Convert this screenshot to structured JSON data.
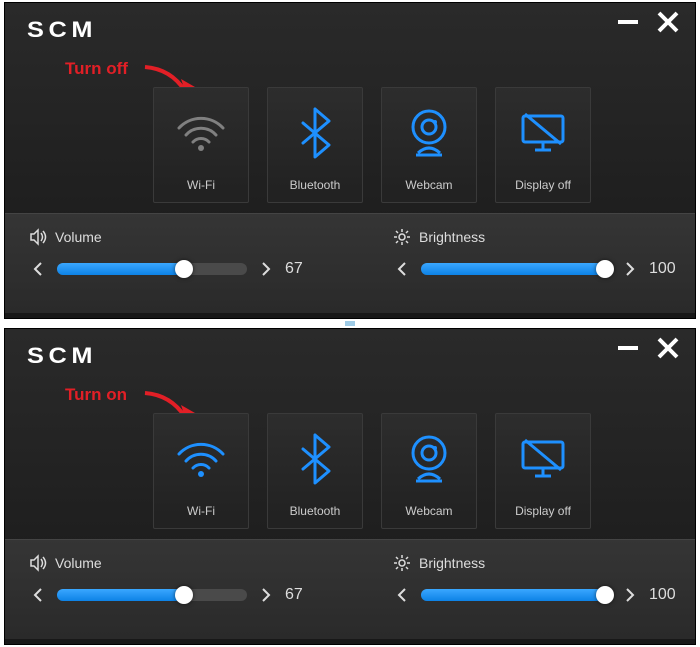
{
  "app_title": "SCM",
  "colors": {
    "accent": "#1e90ff",
    "off": "#808080",
    "annot": "#e21f26"
  },
  "panels": [
    {
      "annotation": "Turn off",
      "wifi_active": false,
      "tiles": [
        {
          "id": "wifi",
          "label": "Wi-Fi"
        },
        {
          "id": "bluetooth",
          "label": "Bluetooth"
        },
        {
          "id": "webcam",
          "label": "Webcam"
        },
        {
          "id": "displayoff",
          "label": "Display off"
        }
      ],
      "volume": {
        "label": "Volume",
        "value": 67,
        "percent": 67
      },
      "brightness": {
        "label": "Brightness",
        "value": 100,
        "percent": 100
      }
    },
    {
      "annotation": "Turn on",
      "wifi_active": true,
      "tiles": [
        {
          "id": "wifi",
          "label": "Wi-Fi"
        },
        {
          "id": "bluetooth",
          "label": "Bluetooth"
        },
        {
          "id": "webcam",
          "label": "Webcam"
        },
        {
          "id": "displayoff",
          "label": "Display off"
        }
      ],
      "volume": {
        "label": "Volume",
        "value": 67,
        "percent": 67
      },
      "brightness": {
        "label": "Brightness",
        "value": 100,
        "percent": 100
      }
    }
  ]
}
